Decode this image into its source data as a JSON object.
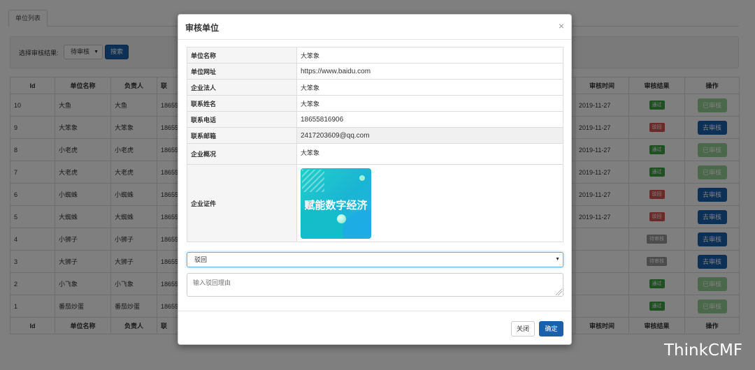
{
  "tabs": {
    "active": "单位列表"
  },
  "filter": {
    "label": "选择审核结果:",
    "selected": "待审核",
    "search_label": "搜索"
  },
  "table": {
    "columns": [
      "Id",
      "单位名称",
      "负责人",
      "联",
      "审核时间",
      "审核结果",
      "操作"
    ],
    "rows": [
      {
        "id": "10",
        "name": "大鱼",
        "leader": "大鱼",
        "phone": "18655",
        "time": "2019-11-27",
        "result": "通过",
        "result_type": "pass",
        "op": "已审核",
        "op_type": "done"
      },
      {
        "id": "9",
        "name": "大笨象",
        "leader": "大笨象",
        "phone": "18655",
        "time": "2019-11-27",
        "result": "驳回",
        "result_type": "reject",
        "op": "去审核",
        "op_type": "go"
      },
      {
        "id": "8",
        "name": "小老虎",
        "leader": "小老虎",
        "phone": "18655",
        "time": "2019-11-27",
        "result": "通过",
        "result_type": "pass",
        "op": "已审核",
        "op_type": "done"
      },
      {
        "id": "7",
        "name": "大老虎",
        "leader": "大老虎",
        "phone": "18655",
        "time": "2019-11-27",
        "result": "通过",
        "result_type": "pass",
        "op": "已审核",
        "op_type": "done"
      },
      {
        "id": "6",
        "name": "小蜘蛛",
        "leader": "小蜘蛛",
        "phone": "18655",
        "time": "2019-11-27",
        "result": "驳回",
        "result_type": "reject",
        "op": "去审核",
        "op_type": "go"
      },
      {
        "id": "5",
        "name": "大蜘蛛",
        "leader": "大蜘蛛",
        "phone": "18655",
        "time": "2019-11-27",
        "result": "驳回",
        "result_type": "reject",
        "op": "去审核",
        "op_type": "go"
      },
      {
        "id": "4",
        "name": "小狮子",
        "leader": "小狮子",
        "phone": "18655",
        "time": "",
        "result": "待审核",
        "result_type": "pending",
        "op": "去审核",
        "op_type": "go"
      },
      {
        "id": "3",
        "name": "大狮子",
        "leader": "大狮子",
        "phone": "18655",
        "time": "",
        "result": "待审核",
        "result_type": "pending",
        "op": "去审核",
        "op_type": "go"
      },
      {
        "id": "2",
        "name": "小飞象",
        "leader": "小飞象",
        "phone": "18655",
        "time": "",
        "result": "通过",
        "result_type": "pass",
        "op": "已审核",
        "op_type": "done"
      },
      {
        "id": "1",
        "name": "番茄炒蛋",
        "leader": "番茄炒蛋",
        "phone": "18655",
        "time": "",
        "result": "通过",
        "result_type": "pass",
        "op": "已审核",
        "op_type": "done"
      }
    ]
  },
  "modal": {
    "title": "审核单位",
    "close_icon": "×",
    "fields": [
      {
        "key": "单位名称",
        "value": "大笨象"
      },
      {
        "key": "单位网址",
        "value": "https://www.baidu.com"
      },
      {
        "key": "企业法人",
        "value": "大笨象"
      },
      {
        "key": "联系姓名",
        "value": "大笨象"
      },
      {
        "key": "联系电话",
        "value": "18655816906"
      },
      {
        "key": "联系邮箱",
        "value": "2417203609@qq.com"
      },
      {
        "key": "企业概况",
        "value": "大笨象"
      }
    ],
    "cert_label": "企业证件",
    "cert_image_text": "赋能数字经济",
    "result_selected": "驳回",
    "reason_placeholder": "输入驳回理由",
    "close_label": "关闭",
    "ok_label": "确定"
  },
  "watermark": "ThinkCMF"
}
